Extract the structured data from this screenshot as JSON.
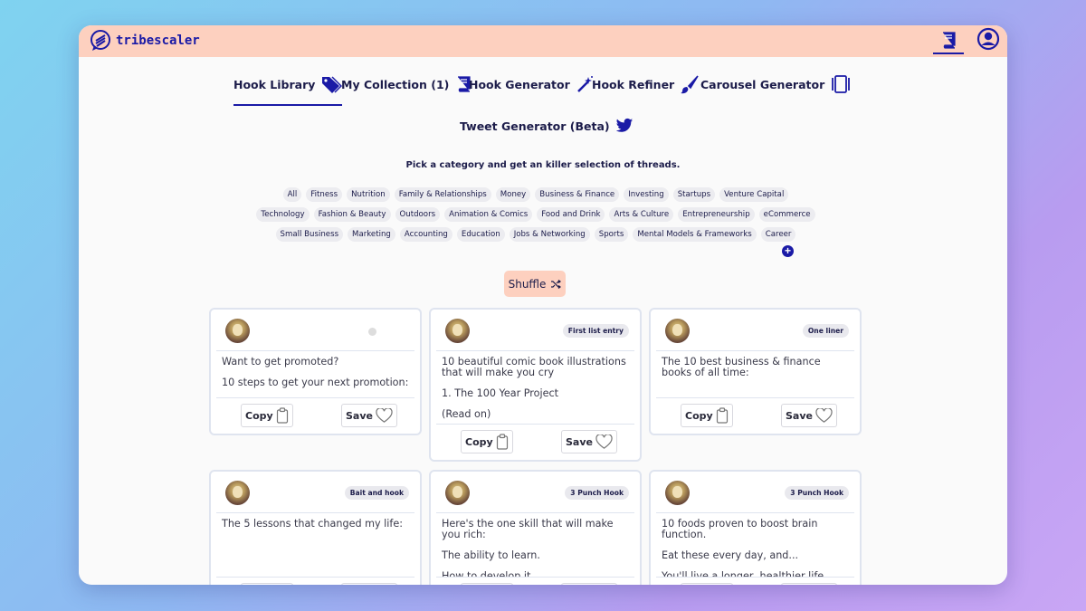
{
  "brand": {
    "name": "tribescaler"
  },
  "nav": {
    "hook_library": "Hook Library",
    "my_collection": "My Collection (1)",
    "hook_generator": "Hook Generator",
    "hook_refiner": "Hook Refiner",
    "carousel_generator": "Carousel Generator",
    "tweet_generator": "Tweet Generator (Beta)"
  },
  "subtitle": "Pick a category and get an killer selection of threads.",
  "categories": {
    "row1": [
      "All",
      "Fitness",
      "Nutrition",
      "Family & Relationships",
      "Money",
      "Business & Finance",
      "Investing",
      "Startups",
      "Venture Capital"
    ],
    "row2": [
      "Technology",
      "Fashion & Beauty",
      "Outdoors",
      "Animation & Comics",
      "Food and Drink",
      "Arts & Culture",
      "Entrepreneurship",
      "eCommerce"
    ],
    "row3": [
      "Small Business",
      "Marketing",
      "Accounting",
      "Education",
      "Jobs & Networking",
      "Sports",
      "Mental Models & Frameworks",
      "Career"
    ]
  },
  "shuffle_label": "Shuffle",
  "buttons": {
    "copy": "Copy",
    "save": "Save"
  },
  "cards": [
    {
      "tag": "",
      "lines": [
        "Want to get promoted?",
        "10 steps to get your next promotion:"
      ]
    },
    {
      "tag": "First list entry",
      "lines": [
        "10 beautiful comic book illustrations that will make you cry",
        "1. The 100 Year Project",
        "(Read on)"
      ]
    },
    {
      "tag": "One liner",
      "lines": [
        "The 10 best business & finance books of all time:"
      ]
    },
    {
      "tag": "Bait and hook",
      "lines": [
        "The 5 lessons that changed my life:"
      ]
    },
    {
      "tag": "3 Punch Hook",
      "lines": [
        "Here's the one skill that will make you rich:",
        "The ability to learn.",
        "How to develop it."
      ]
    },
    {
      "tag": "3 Punch Hook",
      "lines": [
        "10 foods proven to boost brain function.",
        "Eat these every day, and...",
        "You'll live a longer, healthier life."
      ]
    }
  ],
  "colors": {
    "accent": "#1a1aa6",
    "topbar": "#fdd0bf",
    "chip": "#ececf0"
  }
}
